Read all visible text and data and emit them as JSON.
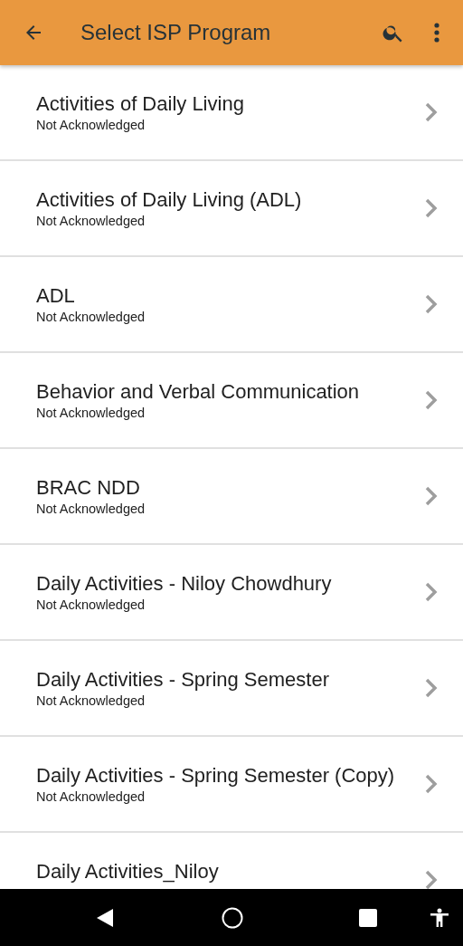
{
  "app_bar": {
    "title": "Select ISP Program"
  },
  "programs": [
    {
      "title": "Activities of Daily Living",
      "status": "Not Acknowledged"
    },
    {
      "title": "Activities of Daily Living (ADL)",
      "status": "Not Acknowledged"
    },
    {
      "title": "ADL",
      "status": "Not Acknowledged"
    },
    {
      "title": "Behavior and Verbal Communication",
      "status": "Not Acknowledged"
    },
    {
      "title": "BRAC NDD",
      "status": "Not Acknowledged"
    },
    {
      "title": "Daily Activities - Niloy Chowdhury",
      "status": "Not Acknowledged"
    },
    {
      "title": "Daily Activities - Spring Semester",
      "status": "Not Acknowledged"
    },
    {
      "title": "Daily Activities - Spring Semester (Copy)",
      "status": "Not Acknowledged"
    },
    {
      "title": "Daily Activities_Niloy"
    }
  ]
}
